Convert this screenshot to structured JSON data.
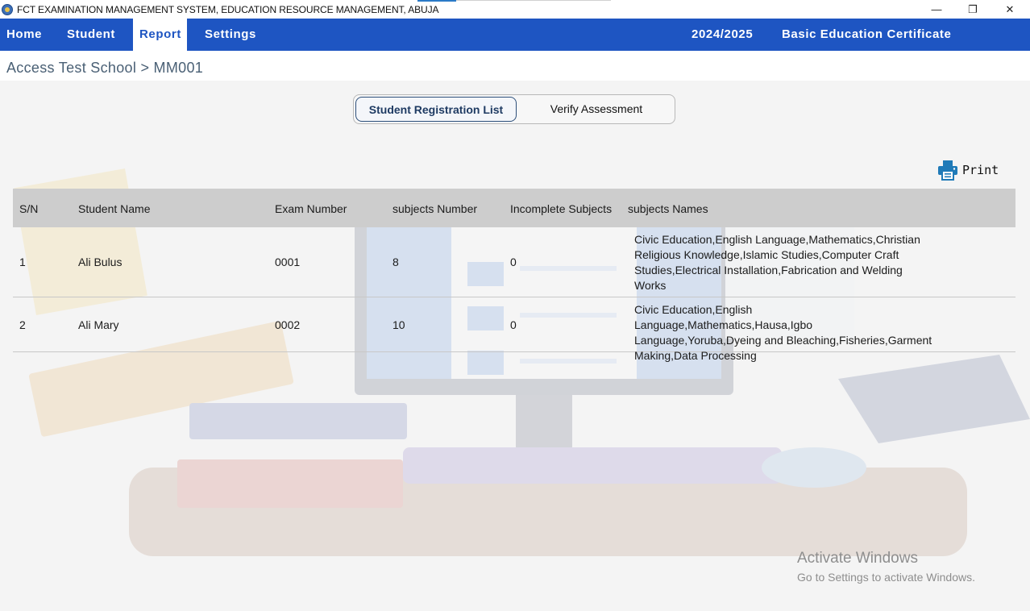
{
  "window": {
    "title": "FCT EXAMINATION MANAGEMENT SYSTEM, EDUCATION RESOURCE MANAGEMENT, ABUJA",
    "minimize_glyph": "—",
    "maximize_glyph": "❐",
    "close_glyph": "✕"
  },
  "nav": {
    "home": "Home",
    "student": "Student",
    "report": "Report",
    "settings": "Settings",
    "session": "2024/2025",
    "exam_name": "Basic Education Certificate Examination",
    "active": "Report"
  },
  "breadcrumb": "Access Test School > MM001",
  "tabs": {
    "registration": "Student Registration List",
    "verify": "Verify Assessment",
    "active": "Student Registration List"
  },
  "print_label": "Print",
  "table": {
    "headers": [
      "S/N",
      "Student Name",
      "Exam Number",
      "subjects Number",
      "Incomplete Subjects",
      "subjects Names"
    ],
    "rows": [
      {
        "sn": "1",
        "name": "Ali  Bulus",
        "exam_number": "0001",
        "subjects_number": "8",
        "incomplete": "0",
        "subjects_names": "Civic Education,English Language,Mathematics,Christian Religious Knowledge,Islamic Studies,Computer Craft Studies,Electrical Installation,Fabrication and Welding Works"
      },
      {
        "sn": "2",
        "name": "Ali  Mary",
        "exam_number": "0002",
        "subjects_number": "10",
        "incomplete": "0",
        "subjects_names": "Civic Education,English Language,Mathematics,Hausa,Igbo Language,Yoruba,Dyeing and Bleaching,Fisheries,Garment Making,Data Processing"
      }
    ]
  },
  "watermark": {
    "title": "Activate Windows",
    "subtitle": "Go to Settings to activate Windows."
  },
  "colors": {
    "nav_bg": "#1e55c2",
    "header_bg": "#cdcdcd",
    "print_icon": "#1f7ab8"
  }
}
